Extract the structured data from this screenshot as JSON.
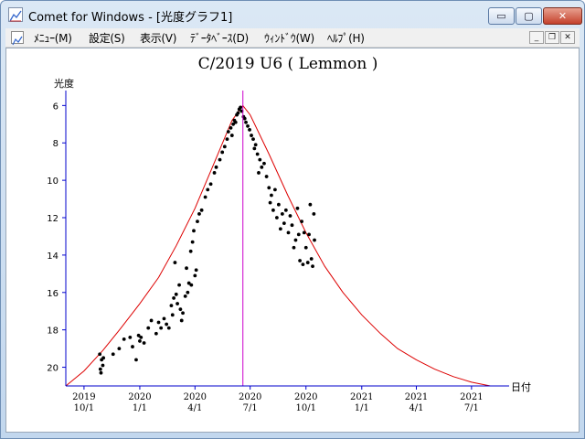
{
  "window": {
    "title": "Comet for Windows - [光度グラフ1]",
    "controls": {
      "minimize": "▭",
      "maximize": "▢",
      "close": "✕"
    }
  },
  "menu": {
    "items": [
      "ﾒﾆｭｰ(M)",
      "設定(S)",
      "表示(V)",
      "ﾃﾞｰﾀﾍﾞｰｽ(D)",
      "ｳｨﾝﾄﾞｳ(W)",
      "ﾍﾙﾌﾟ(H)"
    ],
    "mdi_controls": {
      "minimize": "_",
      "restore": "❐",
      "close": "✕"
    }
  },
  "chart_data": {
    "type": "scatter",
    "title": "C/2019 U6 ( Lemmon )",
    "ylabel": "光度",
    "xlabel": "日付",
    "y_inverted": true,
    "y_ticks": [
      6,
      8,
      10,
      12,
      14,
      16,
      18,
      20
    ],
    "ylim": [
      21,
      5.2
    ],
    "xlim": [
      "2019-09-01",
      "2021-09-01"
    ],
    "x_ticks": [
      {
        "date": "2019-10-01",
        "year": "2019",
        "md": "10/1"
      },
      {
        "date": "2020-01-01",
        "year": "2020",
        "md": "1/1"
      },
      {
        "date": "2020-04-01",
        "year": "2020",
        "md": "4/1"
      },
      {
        "date": "2020-07-01",
        "year": "2020",
        "md": "7/1"
      },
      {
        "date": "2020-10-01",
        "year": "2020",
        "md": "10/1"
      },
      {
        "date": "2021-01-01",
        "year": "2021",
        "md": "1/1"
      },
      {
        "date": "2021-04-01",
        "year": "2021",
        "md": "4/1"
      },
      {
        "date": "2021-07-01",
        "year": "2021",
        "md": "7/1"
      }
    ],
    "perihelion_marker": "2020-06-19",
    "colors": {
      "curve": "#dd0000",
      "marker_line": "#cc00cc",
      "axis": "#0000cc",
      "points": "#000000"
    },
    "model_curve": [
      {
        "x": "2019-09-01",
        "y": 21.0
      },
      {
        "x": "2019-10-01",
        "y": 20.2
      },
      {
        "x": "2019-11-01",
        "y": 19.1
      },
      {
        "x": "2019-12-01",
        "y": 17.9
      },
      {
        "x": "2020-01-01",
        "y": 16.6
      },
      {
        "x": "2020-02-01",
        "y": 15.2
      },
      {
        "x": "2020-03-01",
        "y": 13.5
      },
      {
        "x": "2020-04-01",
        "y": 11.5
      },
      {
        "x": "2020-05-01",
        "y": 9.2
      },
      {
        "x": "2020-06-01",
        "y": 6.8
      },
      {
        "x": "2020-06-19",
        "y": 6.0
      },
      {
        "x": "2020-07-01",
        "y": 6.5
      },
      {
        "x": "2020-08-01",
        "y": 8.6
      },
      {
        "x": "2020-09-01",
        "y": 10.8
      },
      {
        "x": "2020-10-01",
        "y": 12.8
      },
      {
        "x": "2020-11-01",
        "y": 14.6
      },
      {
        "x": "2020-12-01",
        "y": 16.0
      },
      {
        "x": "2021-01-01",
        "y": 17.2
      },
      {
        "x": "2021-02-01",
        "y": 18.2
      },
      {
        "x": "2021-03-01",
        "y": 19.0
      },
      {
        "x": "2021-04-01",
        "y": 19.6
      },
      {
        "x": "2021-05-01",
        "y": 20.1
      },
      {
        "x": "2021-06-01",
        "y": 20.5
      },
      {
        "x": "2021-07-01",
        "y": 20.8
      },
      {
        "x": "2021-08-01",
        "y": 21.0
      }
    ],
    "observations": [
      {
        "x": "2019-10-27",
        "y": 19.3
      },
      {
        "x": "2019-10-28",
        "y": 20.1
      },
      {
        "x": "2019-10-29",
        "y": 20.3
      },
      {
        "x": "2019-10-30",
        "y": 19.6
      },
      {
        "x": "2019-11-01",
        "y": 19.9
      },
      {
        "x": "2019-11-02",
        "y": 19.5
      },
      {
        "x": "2019-11-18",
        "y": 19.3
      },
      {
        "x": "2019-11-28",
        "y": 19.0
      },
      {
        "x": "2019-12-06",
        "y": 18.5
      },
      {
        "x": "2019-12-16",
        "y": 18.4
      },
      {
        "x": "2019-12-20",
        "y": 18.9
      },
      {
        "x": "2019-12-26",
        "y": 19.6
      },
      {
        "x": "2019-12-30",
        "y": 18.3
      },
      {
        "x": "2020-01-01",
        "y": 18.6
      },
      {
        "x": "2020-01-03",
        "y": 18.4
      },
      {
        "x": "2020-01-08",
        "y": 18.7
      },
      {
        "x": "2020-01-15",
        "y": 17.9
      },
      {
        "x": "2020-01-20",
        "y": 17.5
      },
      {
        "x": "2020-01-28",
        "y": 18.2
      },
      {
        "x": "2020-02-01",
        "y": 17.6
      },
      {
        "x": "2020-02-05",
        "y": 17.9
      },
      {
        "x": "2020-02-10",
        "y": 17.4
      },
      {
        "x": "2020-02-14",
        "y": 17.7
      },
      {
        "x": "2020-02-18",
        "y": 17.9
      },
      {
        "x": "2020-02-22",
        "y": 16.7
      },
      {
        "x": "2020-02-24",
        "y": 17.2
      },
      {
        "x": "2020-02-26",
        "y": 16.3
      },
      {
        "x": "2020-02-28",
        "y": 14.4
      },
      {
        "x": "2020-03-01",
        "y": 16.1
      },
      {
        "x": "2020-03-03",
        "y": 16.6
      },
      {
        "x": "2020-03-06",
        "y": 15.6
      },
      {
        "x": "2020-03-08",
        "y": 16.9
      },
      {
        "x": "2020-03-10",
        "y": 17.5
      },
      {
        "x": "2020-03-12",
        "y": 17.1
      },
      {
        "x": "2020-03-16",
        "y": 16.2
      },
      {
        "x": "2020-03-18",
        "y": 14.7
      },
      {
        "x": "2020-03-20",
        "y": 16.0
      },
      {
        "x": "2020-03-22",
        "y": 15.5
      },
      {
        "x": "2020-03-25",
        "y": 13.8
      },
      {
        "x": "2020-03-26",
        "y": 15.6
      },
      {
        "x": "2020-03-28",
        "y": 13.3
      },
      {
        "x": "2020-03-30",
        "y": 12.7
      },
      {
        "x": "2020-04-01",
        "y": 15.1
      },
      {
        "x": "2020-04-03",
        "y": 14.8
      },
      {
        "x": "2020-04-05",
        "y": 12.2
      },
      {
        "x": "2020-04-08",
        "y": 11.8
      },
      {
        "x": "2020-04-12",
        "y": 11.6
      },
      {
        "x": "2020-04-18",
        "y": 10.9
      },
      {
        "x": "2020-04-22",
        "y": 10.5
      },
      {
        "x": "2020-04-27",
        "y": 10.2
      },
      {
        "x": "2020-05-03",
        "y": 9.6
      },
      {
        "x": "2020-05-06",
        "y": 9.3
      },
      {
        "x": "2020-05-12",
        "y": 8.9
      },
      {
        "x": "2020-05-16",
        "y": 8.5
      },
      {
        "x": "2020-05-20",
        "y": 8.2
      },
      {
        "x": "2020-05-24",
        "y": 7.8
      },
      {
        "x": "2020-05-26",
        "y": 7.4
      },
      {
        "x": "2020-05-30",
        "y": 7.2
      },
      {
        "x": "2020-06-01",
        "y": 7.6
      },
      {
        "x": "2020-06-03",
        "y": 7.0
      },
      {
        "x": "2020-06-05",
        "y": 6.8
      },
      {
        "x": "2020-06-07",
        "y": 6.9
      },
      {
        "x": "2020-06-09",
        "y": 6.5
      },
      {
        "x": "2020-06-11",
        "y": 6.4
      },
      {
        "x": "2020-06-13",
        "y": 6.2
      },
      {
        "x": "2020-06-15",
        "y": 6.1
      },
      {
        "x": "2020-06-17",
        "y": 6.3
      },
      {
        "x": "2020-06-20",
        "y": 6.6
      },
      {
        "x": "2020-06-22",
        "y": 6.7
      },
      {
        "x": "2020-06-24",
        "y": 6.9
      },
      {
        "x": "2020-06-27",
        "y": 7.1
      },
      {
        "x": "2020-06-30",
        "y": 7.3
      },
      {
        "x": "2020-07-03",
        "y": 7.6
      },
      {
        "x": "2020-07-06",
        "y": 7.8
      },
      {
        "x": "2020-07-08",
        "y": 8.3
      },
      {
        "x": "2020-07-10",
        "y": 8.1
      },
      {
        "x": "2020-07-13",
        "y": 8.6
      },
      {
        "x": "2020-07-15",
        "y": 9.6
      },
      {
        "x": "2020-07-17",
        "y": 8.9
      },
      {
        "x": "2020-07-20",
        "y": 9.3
      },
      {
        "x": "2020-07-24",
        "y": 9.1
      },
      {
        "x": "2020-07-28",
        "y": 9.8
      },
      {
        "x": "2020-08-01",
        "y": 10.4
      },
      {
        "x": "2020-08-03",
        "y": 11.2
      },
      {
        "x": "2020-08-05",
        "y": 10.8
      },
      {
        "x": "2020-08-08",
        "y": 11.6
      },
      {
        "x": "2020-08-11",
        "y": 10.5
      },
      {
        "x": "2020-08-14",
        "y": 12.0
      },
      {
        "x": "2020-08-17",
        "y": 11.3
      },
      {
        "x": "2020-08-20",
        "y": 12.6
      },
      {
        "x": "2020-08-23",
        "y": 11.8
      },
      {
        "x": "2020-08-26",
        "y": 12.3
      },
      {
        "x": "2020-08-29",
        "y": 11.6
      },
      {
        "x": "2020-09-02",
        "y": 12.8
      },
      {
        "x": "2020-09-05",
        "y": 11.9
      },
      {
        "x": "2020-09-08",
        "y": 12.4
      },
      {
        "x": "2020-09-11",
        "y": 13.6
      },
      {
        "x": "2020-09-14",
        "y": 13.2
      },
      {
        "x": "2020-09-17",
        "y": 11.5
      },
      {
        "x": "2020-09-19",
        "y": 12.9
      },
      {
        "x": "2020-09-21",
        "y": 14.3
      },
      {
        "x": "2020-09-24",
        "y": 12.2
      },
      {
        "x": "2020-09-26",
        "y": 14.5
      },
      {
        "x": "2020-09-28",
        "y": 12.8
      },
      {
        "x": "2020-10-01",
        "y": 13.6
      },
      {
        "x": "2020-10-04",
        "y": 14.4
      },
      {
        "x": "2020-10-06",
        "y": 12.9
      },
      {
        "x": "2020-10-08",
        "y": 11.3
      },
      {
        "x": "2020-10-10",
        "y": 14.2
      },
      {
        "x": "2020-10-12",
        "y": 14.6
      },
      {
        "x": "2020-10-14",
        "y": 11.8
      },
      {
        "x": "2020-10-15",
        "y": 13.2
      }
    ]
  }
}
